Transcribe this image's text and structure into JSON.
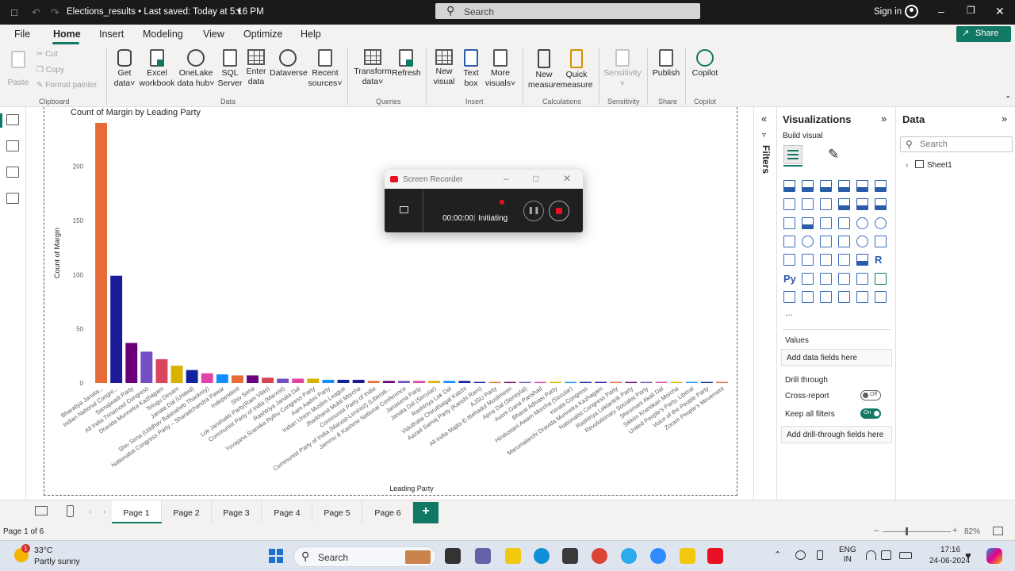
{
  "titlebar": {
    "doc_title": "Elections_results • Last saved: Today at 5:16 PM",
    "search_placeholder": "Search",
    "sign_in": "Sign in"
  },
  "menu": {
    "file": "File",
    "home": "Home",
    "insert": "Insert",
    "modeling": "Modeling",
    "view": "View",
    "optimize": "Optimize",
    "help": "Help",
    "share": "Share"
  },
  "ribbon": {
    "clipboard": {
      "paste": "Paste",
      "cut": "Cut",
      "copy": "Copy",
      "format_painter": "Format painter",
      "label": "Clipboard"
    },
    "data": {
      "get_data": [
        "Get",
        "data"
      ],
      "excel": [
        "Excel",
        "workbook"
      ],
      "onelake": [
        "OneLake",
        "data hub"
      ],
      "sql": [
        "SQL",
        "Server"
      ],
      "enter_data": [
        "Enter",
        "data"
      ],
      "dataverse": "Dataverse",
      "recent": [
        "Recent",
        "sources"
      ],
      "label": "Data"
    },
    "queries": {
      "transform": [
        "Transform",
        "data"
      ],
      "refresh": "Refresh",
      "label": "Queries"
    },
    "insert": {
      "new_visual": [
        "New",
        "visual"
      ],
      "text_box": [
        "Text",
        "box"
      ],
      "more_visuals": [
        "More",
        "visuals"
      ],
      "label": "Insert"
    },
    "calculations": {
      "new_measure": [
        "New",
        "measure"
      ],
      "quick_measure": [
        "Quick",
        "measure"
      ],
      "label": "Calculations"
    },
    "sensitivity": {
      "btn": "Sensitivity",
      "label": "Sensitivity"
    },
    "share": {
      "publish": "Publish",
      "label": "Share"
    },
    "copilot": {
      "btn": "Copilot",
      "label": "Copilot"
    }
  },
  "chart_data": {
    "type": "bar",
    "title": "Count of Margin by Leading Party",
    "xlabel": "Leading Party",
    "ylabel": "Count of Margin",
    "ylim": [
      0,
      240
    ],
    "yticks": [
      0,
      50,
      100,
      150,
      200
    ],
    "grid": false,
    "categories": [
      "Bharatiya Janata...",
      "Indian National Congre...",
      "Samajwadi Party",
      "All India Trinamool Congress",
      "Dravida Munnetra Kazhagam",
      "Telugu Desam",
      "Janata Dal (United)",
      "Shiv Sena (Uddhav Balasaheb Thackrey)",
      "Nationalist Congress Party – Sharadchandra Pawar",
      "Independent",
      "Shiv Sena",
      "Lok Janshakti Party(Ram Vilas)",
      "Communist Party of India (Marxist)",
      "Rashtriya Janata Dal",
      "Yuvajana Sramika Rythu Congress Party",
      "Aam Aadmi Party",
      "Indian Union Muslim League",
      "Jharkhand Mukti Morcha",
      "Communist Party of India",
      "Communist Party of India (Marxist-Leninist) (Liberati...",
      "Jammu & Kashmir National Conference",
      "Janasena Party",
      "Janata Dal (Secular)",
      "Rashtriya Lok Dal",
      "Viduthalai Chiruthaigal Katchi",
      "Aazad Samaj Party (Kanshi Ram)",
      "AJSU Party",
      "All India Majlis-E-Ittehadul Muslimeen",
      "Apna Dal (Soneylal)",
      "Asom Gana Parishad",
      "Bharat Adivasi Party",
      "Hindustani Awam Morcha (Secular)",
      "Kerala Congress",
      "Marumalarchi Dravida Munnetra Kazhagam",
      "Nationalist Congress Party",
      "Rashtriya Loktantrik Party",
      "Revolutionary Socialist Party",
      "Shiromani Akali Dal",
      "Sikkim Krantikari Morcha",
      "United People's Party, Liberal",
      "Voice of the People Party",
      "Zoram People's Movement"
    ],
    "values": [
      240,
      99,
      37,
      29,
      22,
      16,
      12,
      9,
      8,
      7,
      7,
      5,
      4,
      4,
      4,
      3,
      3,
      3,
      2,
      2,
      2,
      2,
      2,
      2,
      2,
      1,
      1,
      1,
      1,
      1,
      1,
      1,
      1,
      1,
      1,
      1,
      1,
      1,
      1,
      1,
      1,
      1
    ],
    "colors": [
      "#e66c37",
      "#1b1b9a",
      "#6b007b",
      "#744ec2",
      "#d9465d",
      "#d9b300",
      "#12239e",
      "#e044a7",
      "#118dff",
      "#e66c37",
      "#6b007b",
      "#d64550",
      "#744ec2",
      "#e044a7",
      "#d9b300",
      "#118dff",
      "#12239e",
      "#1b1b9a",
      "#e66c37",
      "#6b007b",
      "#744ec2",
      "#e044a7",
      "#d9b300",
      "#118dff",
      "#12239e",
      "#1b1b9a",
      "#e66c37",
      "#6b007b",
      "#744ec2",
      "#e044a7",
      "#d9b300",
      "#118dff",
      "#12239e",
      "#1b1b9a",
      "#e66c37",
      "#6b007b",
      "#744ec2",
      "#e044a7",
      "#d9b300",
      "#118dff",
      "#12239e",
      "#e66c37"
    ]
  },
  "recorder": {
    "title": "Screen Recorder",
    "time": "00:00:00",
    "status": "Initiating"
  },
  "filters": {
    "label": "Filters"
  },
  "visualizations": {
    "title": "Visualizations",
    "build_visual": "Build visual",
    "python_label": "Py",
    "r_label": "R",
    "more": "...",
    "values_label": "Values",
    "values_placeholder": "Add data fields here",
    "drill_through": "Drill through",
    "cross_report": "Cross-report",
    "cross_report_state": "Off",
    "keep_all_filters": "Keep all filters",
    "keep_all_filters_state": "On",
    "drill_placeholder": "Add drill-through fields here"
  },
  "datapane": {
    "title": "Data",
    "search_placeholder": "Search",
    "tables": [
      "Sheet1"
    ]
  },
  "pages": {
    "tabs": [
      "Page 1",
      "Page 2",
      "Page 3",
      "Page 4",
      "Page 5",
      "Page 6"
    ],
    "active": "Page 1",
    "add": "+"
  },
  "status": {
    "page_of": "Page 1 of 6",
    "zoom": "82%"
  },
  "taskbar": {
    "temp": "33°C",
    "weather": "Partly sunny",
    "weather_badge": "1",
    "search": "Search",
    "lang_1": "ENG",
    "lang_2": "IN",
    "time": "17:16",
    "date": "24-06-2024"
  }
}
